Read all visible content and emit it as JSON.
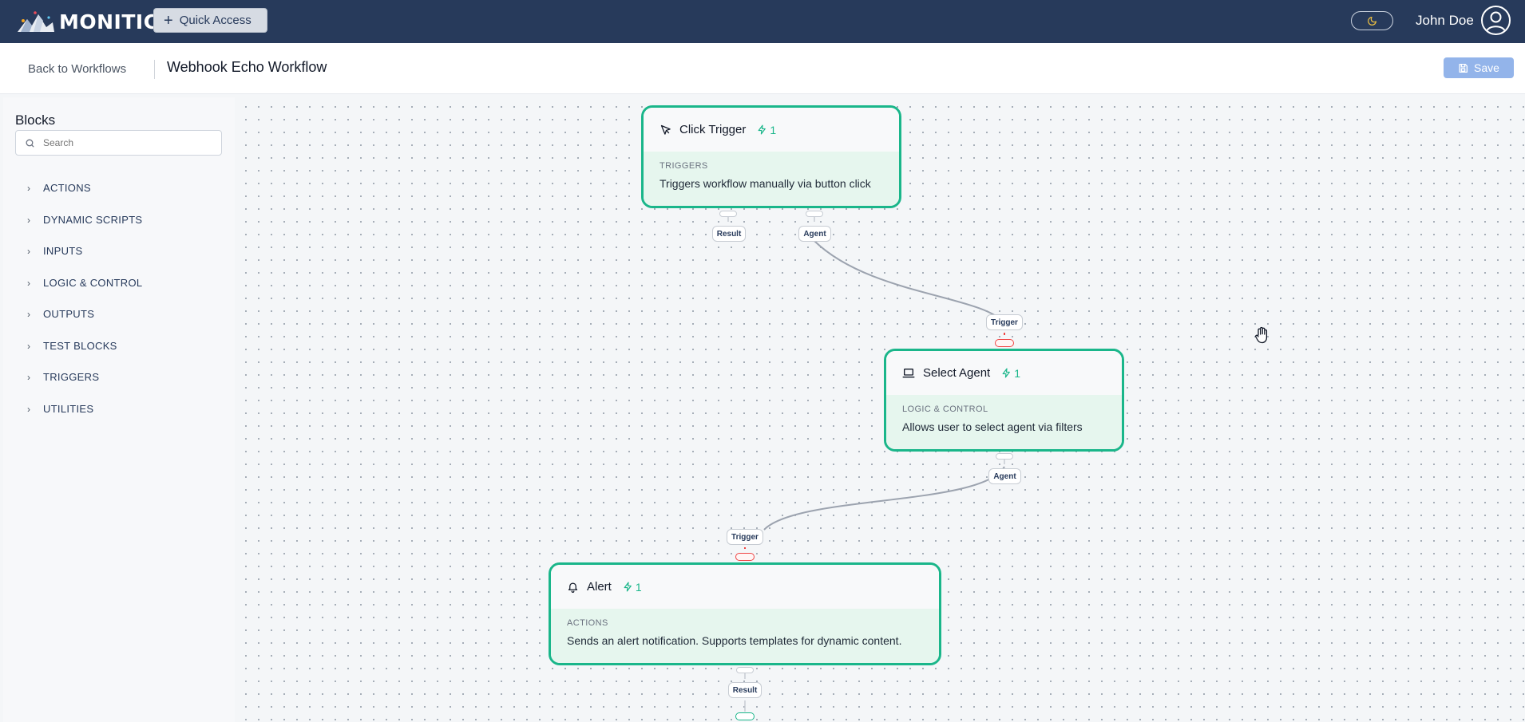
{
  "app": {
    "logo_text": "MONITIC"
  },
  "topbar": {
    "quick_access_label": "Quick Access",
    "user_name": "John Doe"
  },
  "subheader": {
    "back_label": "Back to Workflows",
    "title": "Webhook Echo Workflow",
    "save_label": "Save"
  },
  "sidebar": {
    "title": "Blocks",
    "search_placeholder": "Search",
    "categories": [
      "ACTIONS",
      "DYNAMIC SCRIPTS",
      "INPUTS",
      "LOGIC & CONTROL",
      "OUTPUTS",
      "TEST BLOCKS",
      "TRIGGERS",
      "UTILITIES"
    ]
  },
  "nodes": {
    "click_trigger": {
      "title": "Click Trigger",
      "count": "1",
      "category": "TRIGGERS",
      "description": "Triggers workflow manually via button click",
      "icon": "cursor-icon",
      "outputs": [
        "Result",
        "Agent"
      ]
    },
    "select_agent": {
      "title": "Select Agent",
      "count": "1",
      "category": "LOGIC & CONTROL",
      "description": "Allows user to select agent via filters",
      "icon": "laptop-icon",
      "input": "Trigger",
      "outputs": [
        "Agent"
      ]
    },
    "alert": {
      "title": "Alert",
      "count": "1",
      "category": "ACTIONS",
      "description": "Sends an alert notification. Supports templates for dynamic content.",
      "icon": "bell-icon",
      "input": "Trigger",
      "outputs": [
        "Result"
      ]
    }
  },
  "colors": {
    "topbar": "#273a5b",
    "accent": "#1ab68a",
    "save_button": "#93b4ea",
    "error_handle": "#ef4444"
  }
}
